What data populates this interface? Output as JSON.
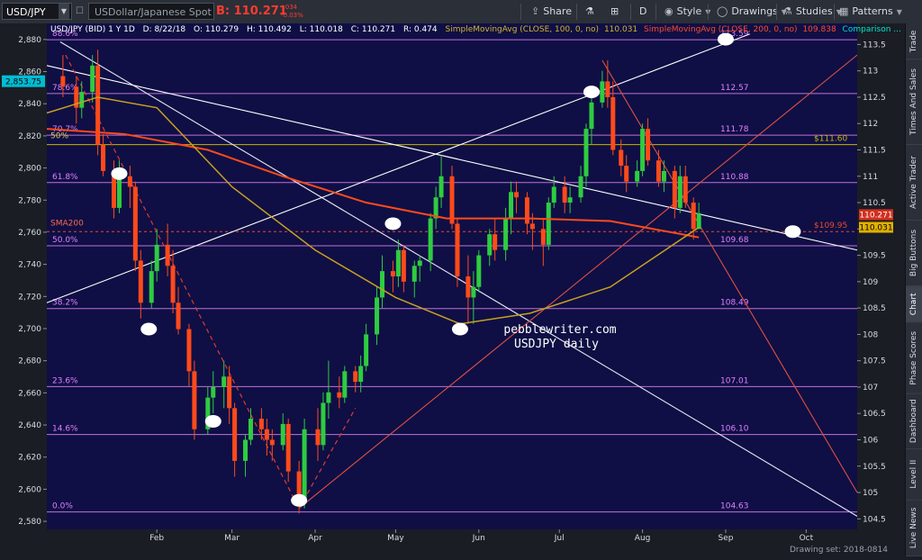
{
  "toolbar": {
    "symbol": "USD/JPY",
    "description": "USDollar/Japanese Spot",
    "last_price": "B: 110.271",
    "change_abs": "-.034",
    "change_pct": "-0.03%",
    "share_label": "Share",
    "period_label": "D",
    "style_label": "Style",
    "drawings_label": "Drawings",
    "studies_label": "Studies",
    "patterns_label": "Patterns"
  },
  "sidebar": {
    "tabs": [
      {
        "label": "Trade",
        "active": false
      },
      {
        "label": "Times And Sales",
        "active": false
      },
      {
        "label": "Active Trader",
        "active": false
      },
      {
        "label": "Big Buttons",
        "active": false
      },
      {
        "label": "Chart",
        "active": true
      },
      {
        "label": "Phase Scores",
        "active": false
      },
      {
        "label": "Dashboard",
        "active": false
      },
      {
        "label": "Level II",
        "active": false
      },
      {
        "label": "Live News",
        "active": false
      }
    ]
  },
  "chart_data": {
    "type": "candlestick",
    "header": {
      "instrument": "USD/JPY (BID) 1 Y 1D",
      "date": "D: 8/22/18",
      "open": "O: 110.279",
      "high": "H: 110.492",
      "low": "L: 110.018",
      "close": "C: 110.271",
      "range": "R: 0.474",
      "sma100_label": "SimpleMovingAvg (CLOSE, 100, 0, no)",
      "sma100_value": "110.031",
      "sma200_label": "SimpleMovingAvg (CLOSE, 200, 0, no)",
      "sma200_value": "109.838",
      "comparison_label": "Comparison ..."
    },
    "watermark": [
      "pebblewriter.com",
      "USDJPY daily"
    ],
    "left_axis": {
      "ticks": [
        "2,880",
        "2,860",
        "2,840",
        "2,820",
        "2,800",
        "2,780",
        "2,760",
        "2,740",
        "2,720",
        "2,700",
        "2,680",
        "2,660",
        "2,640",
        "2,620",
        "2,600",
        "2,580"
      ],
      "tick_values": [
        2880,
        2860,
        2840,
        2820,
        2800,
        2780,
        2760,
        2740,
        2720,
        2700,
        2680,
        2660,
        2640,
        2620,
        2600,
        2580
      ],
      "range": [
        2575,
        2890
      ],
      "marker": "2,853.75",
      "marker_value": 2853.75
    },
    "right_axis": {
      "ticks": [
        "113.5",
        "113",
        "112.5",
        "112",
        "111.5",
        "111",
        "110.5",
        "110",
        "109.5",
        "109",
        "108.5",
        "108",
        "107.5",
        "107",
        "106.5",
        "106",
        "105.5",
        "105",
        "104.5"
      ],
      "tick_values": [
        113.5,
        113,
        112.5,
        112,
        111.5,
        111,
        110.5,
        110,
        109.5,
        109,
        108.5,
        108,
        107.5,
        107,
        106.5,
        106,
        105.5,
        105,
        104.5
      ],
      "range": [
        104.3,
        113.9
      ],
      "badges": [
        {
          "label": "110.271",
          "value": 110.271,
          "color": "#d3301f",
          "text_color": "#ffffff"
        },
        {
          "label": "110.031",
          "value": 110.031,
          "color": "#e0b000",
          "text_color": "#000000"
        }
      ]
    },
    "x_axis": {
      "labels": [
        "Feb",
        "Mar",
        "Apr",
        "May",
        "Jun",
        "Jul",
        "Aug",
        "Sep",
        "Oct"
      ],
      "label_dates": [
        "2018-02-01",
        "2018-03-01",
        "2018-04-01",
        "2018-05-01",
        "2018-06-01",
        "2018-07-01",
        "2018-08-01",
        "2018-09-01",
        "2018-10-01"
      ]
    },
    "fib_levels": [
      {
        "pct": "88.6%",
        "price": "113.59",
        "value": 113.59
      },
      {
        "pct": "78.6%",
        "price": "112.57",
        "value": 112.57
      },
      {
        "pct": "70.7%",
        "price": "111.78",
        "value": 111.78
      },
      {
        "pct": "61.8%",
        "price": "110.88",
        "value": 110.88
      },
      {
        "pct": "50.0%",
        "price": "109.68",
        "value": 109.68
      },
      {
        "pct": "38.2%",
        "price": "108.49",
        "value": 108.49
      },
      {
        "pct": "23.6%",
        "price": "107.01",
        "value": 107.01
      },
      {
        "pct": "14.6%",
        "price": "106.10",
        "value": 106.1
      },
      {
        "pct": "0.0%",
        "price": "104.63",
        "value": 104.63
      }
    ],
    "horizontal_lines": [
      {
        "label": "$111.60",
        "value": 111.6,
        "color": "#c8b400"
      },
      {
        "label": "$109.95",
        "value": 109.95,
        "color": "#e84a2a"
      }
    ],
    "annotations": {
      "sma200_tag": "SMA200",
      "fifty_tag": "50%"
    },
    "candles": [
      [
        "2017-12-28",
        112.9,
        113.3,
        112.5,
        112.7
      ],
      [
        "2018-01-02",
        112.7,
        112.9,
        112.0,
        112.3
      ],
      [
        "2018-01-04",
        112.3,
        112.8,
        112.1,
        112.6
      ],
      [
        "2018-01-08",
        112.6,
        113.3,
        112.4,
        113.1
      ],
      [
        "2018-01-10",
        113.1,
        113.4,
        111.4,
        111.6
      ],
      [
        "2018-01-12",
        111.6,
        111.8,
        111.0,
        111.1
      ],
      [
        "2018-01-16",
        111.1,
        111.3,
        110.2,
        110.4
      ],
      [
        "2018-01-18",
        110.4,
        111.3,
        110.3,
        111.0
      ],
      [
        "2018-01-22",
        111.0,
        111.2,
        110.4,
        110.8
      ],
      [
        "2018-01-24",
        110.8,
        110.9,
        109.2,
        109.4
      ],
      [
        "2018-01-26",
        109.4,
        109.6,
        108.3,
        108.6
      ],
      [
        "2018-01-30",
        108.6,
        109.4,
        108.5,
        109.2
      ],
      [
        "2018-02-01",
        109.2,
        110.0,
        109.0,
        109.7
      ],
      [
        "2018-02-05",
        109.7,
        110.1,
        109.1,
        109.3
      ],
      [
        "2018-02-07",
        109.3,
        109.6,
        108.4,
        108.6
      ],
      [
        "2018-02-09",
        108.6,
        108.9,
        108.0,
        108.1
      ],
      [
        "2018-02-13",
        108.1,
        108.2,
        107.0,
        107.3
      ],
      [
        "2018-02-15",
        107.3,
        107.5,
        106.0,
        106.2
      ],
      [
        "2018-02-20",
        106.2,
        107.0,
        106.1,
        106.8
      ],
      [
        "2018-02-22",
        106.8,
        107.3,
        106.5,
        107.0
      ],
      [
        "2018-02-26",
        107.0,
        107.5,
        106.6,
        107.2
      ],
      [
        "2018-02-28",
        107.2,
        107.4,
        106.3,
        106.6
      ],
      [
        "2018-03-02",
        106.6,
        106.7,
        105.3,
        105.6
      ],
      [
        "2018-03-06",
        105.6,
        106.1,
        105.3,
        106.0
      ],
      [
        "2018-03-08",
        106.0,
        106.6,
        105.9,
        106.4
      ],
      [
        "2018-03-12",
        106.4,
        106.6,
        106.0,
        106.2
      ],
      [
        "2018-03-14",
        106.2,
        106.4,
        105.7,
        106.0
      ],
      [
        "2018-03-16",
        106.0,
        106.2,
        105.6,
        105.9
      ],
      [
        "2018-03-20",
        105.9,
        106.5,
        105.8,
        106.3
      ],
      [
        "2018-03-22",
        106.3,
        106.4,
        105.2,
        105.4
      ],
      [
        "2018-03-26",
        105.4,
        105.6,
        104.6,
        104.8
      ],
      [
        "2018-03-28",
        104.8,
        106.4,
        104.7,
        106.2
      ],
      [
        "2018-04-02",
        106.2,
        106.6,
        105.6,
        105.9
      ],
      [
        "2018-04-04",
        105.9,
        106.9,
        105.8,
        106.7
      ],
      [
        "2018-04-06",
        106.7,
        107.5,
        106.4,
        106.9
      ],
      [
        "2018-04-10",
        106.9,
        107.2,
        106.6,
        106.8
      ],
      [
        "2018-04-12",
        106.8,
        107.4,
        106.7,
        107.3
      ],
      [
        "2018-04-16",
        107.3,
        107.4,
        106.9,
        107.1
      ],
      [
        "2018-04-18",
        107.1,
        107.6,
        106.9,
        107.4
      ],
      [
        "2018-04-20",
        107.4,
        108.2,
        107.3,
        108.0
      ],
      [
        "2018-04-24",
        108.0,
        108.9,
        107.8,
        108.7
      ],
      [
        "2018-04-26",
        108.7,
        109.5,
        108.5,
        109.2
      ],
      [
        "2018-04-30",
        109.2,
        109.4,
        108.8,
        109.1
      ],
      [
        "2018-05-02",
        109.1,
        109.8,
        108.9,
        109.6
      ],
      [
        "2018-05-04",
        109.6,
        109.7,
        108.8,
        109.0
      ],
      [
        "2018-05-08",
        109.0,
        109.4,
        108.7,
        109.3
      ],
      [
        "2018-05-10",
        109.3,
        109.5,
        109.0,
        109.4
      ],
      [
        "2018-05-14",
        109.4,
        110.3,
        109.2,
        110.2
      ],
      [
        "2018-05-16",
        110.2,
        110.8,
        110.0,
        110.6
      ],
      [
        "2018-05-18",
        110.6,
        111.4,
        110.4,
        111.0
      ],
      [
        "2018-05-22",
        111.0,
        111.2,
        110.0,
        110.1
      ],
      [
        "2018-05-24",
        110.1,
        110.2,
        108.9,
        109.1
      ],
      [
        "2018-05-28",
        109.1,
        109.5,
        108.2,
        108.7
      ],
      [
        "2018-05-30",
        108.7,
        109.2,
        108.2,
        108.9
      ],
      [
        "2018-06-01",
        108.9,
        109.6,
        108.8,
        109.5
      ],
      [
        "2018-06-05",
        109.5,
        110.0,
        109.3,
        109.9
      ],
      [
        "2018-06-07",
        109.9,
        110.2,
        109.4,
        109.6
      ],
      [
        "2018-06-11",
        109.6,
        110.4,
        109.4,
        110.2
      ],
      [
        "2018-06-13",
        110.2,
        110.9,
        109.9,
        110.7
      ],
      [
        "2018-06-15",
        110.7,
        110.9,
        110.3,
        110.6
      ],
      [
        "2018-06-19",
        110.6,
        110.7,
        109.9,
        110.1
      ],
      [
        "2018-06-21",
        110.1,
        110.3,
        109.6,
        110.0
      ],
      [
        "2018-06-25",
        110.0,
        110.2,
        109.3,
        109.7
      ],
      [
        "2018-06-27",
        109.7,
        110.6,
        109.6,
        110.5
      ],
      [
        "2018-06-29",
        110.5,
        111.0,
        110.4,
        110.8
      ],
      [
        "2018-07-03",
        110.8,
        111.0,
        110.3,
        110.5
      ],
      [
        "2018-07-05",
        110.5,
        110.8,
        110.3,
        110.6
      ],
      [
        "2018-07-09",
        110.6,
        111.2,
        110.5,
        111.0
      ],
      [
        "2018-07-11",
        111.0,
        112.0,
        110.8,
        111.9
      ],
      [
        "2018-07-13",
        111.9,
        112.6,
        111.6,
        112.4
      ],
      [
        "2018-07-17",
        112.4,
        113.0,
        112.3,
        112.8
      ],
      [
        "2018-07-19",
        112.8,
        113.2,
        112.3,
        112.5
      ],
      [
        "2018-07-21",
        112.5,
        112.8,
        111.4,
        111.5
      ],
      [
        "2018-07-24",
        111.5,
        111.7,
        111.0,
        111.2
      ],
      [
        "2018-07-26",
        111.2,
        111.4,
        110.7,
        110.9
      ],
      [
        "2018-07-30",
        110.9,
        111.3,
        110.8,
        111.1
      ],
      [
        "2018-08-01",
        111.1,
        112.0,
        111.0,
        111.9
      ],
      [
        "2018-08-03",
        111.9,
        112.1,
        111.2,
        111.3
      ],
      [
        "2018-08-07",
        111.3,
        111.5,
        110.8,
        110.9
      ],
      [
        "2018-08-09",
        110.9,
        111.3,
        110.7,
        111.1
      ],
      [
        "2018-08-13",
        111.1,
        111.2,
        110.2,
        110.4
      ],
      [
        "2018-08-15",
        110.4,
        111.2,
        110.3,
        111.0
      ],
      [
        "2018-08-17",
        111.0,
        111.2,
        110.4,
        110.5
      ],
      [
        "2018-08-20",
        110.5,
        110.6,
        109.8,
        110.0
      ],
      [
        "2018-08-22",
        110.0,
        110.5,
        110.0,
        110.3
      ]
    ]
  }
}
